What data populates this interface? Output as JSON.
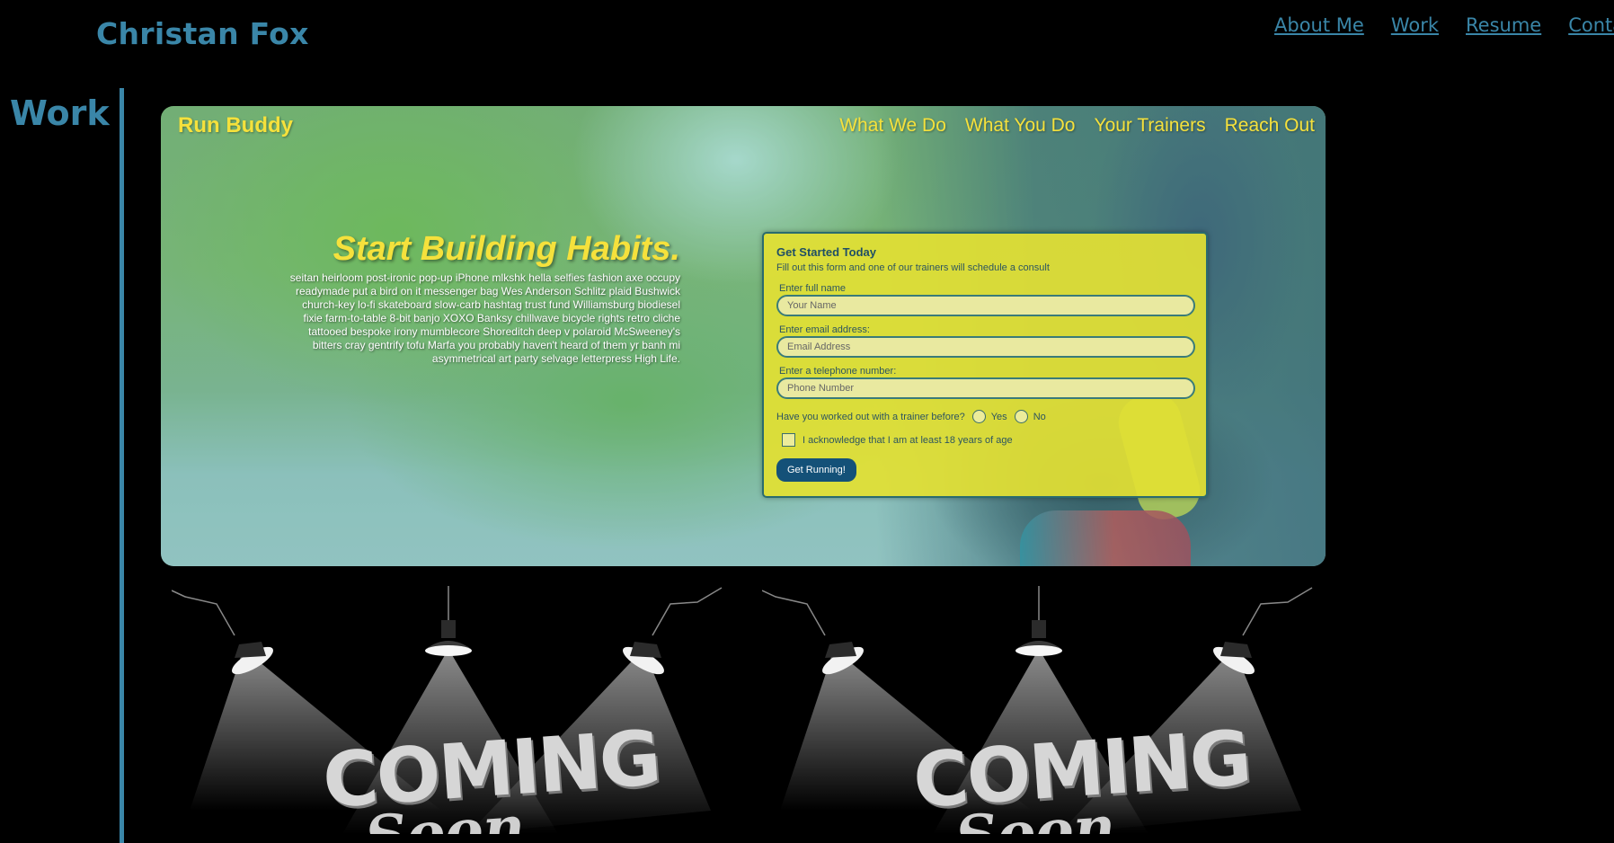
{
  "header": {
    "brand": "Christan Fox",
    "nav": [
      "About Me",
      "Work",
      "Resume",
      "Contac"
    ]
  },
  "section": {
    "title": "Work"
  },
  "project": {
    "logo": "Run Buddy",
    "nav": [
      "What We Do",
      "What You Do",
      "Your Trainers",
      "Reach Out"
    ],
    "hero_title": "Start Building Habits.",
    "hero_text": "seitan heirloom post-ironic pop-up iPhone mlkshk hella selfies fashion axe occupy readymade put a bird on it messenger bag Wes Anderson Schlitz plaid Bushwick church-key lo-fi skateboard slow-carb hashtag trust fund Williamsburg biodiesel fixie farm-to-table 8-bit banjo XOXO Banksy chillwave bicycle rights retro cliche tattooed bespoke irony mumblecore Shoreditch deep v polaroid McSweeney's bitters cray gentrify tofu Marfa you probably haven't heard of them yr banh mi asymmetrical art party selvage letterpress High Life.",
    "form": {
      "title": "Get Started Today",
      "subtitle": "Fill out this form and one of our trainers will schedule a consult",
      "name_label": "Enter full name",
      "name_placeholder": "Your Name",
      "email_label": "Enter email address:",
      "email_placeholder": "Email Address",
      "phone_label": "Enter a telephone number:",
      "phone_placeholder": "Phone Number",
      "question": "Have you worked out with a trainer before?",
      "yes": "Yes",
      "no": "No",
      "acknowledge": "I acknowledge that I am at least 18 years of age",
      "submit": "Get Running!"
    }
  },
  "placeholders": [
    {
      "line1": "COMING",
      "line2": "Soon"
    },
    {
      "line1": "COMING",
      "line2": "Soon"
    }
  ],
  "colors": {
    "accent": "#3a86a8",
    "runbuddy_yellow": "#f5e13c",
    "form_bg": "#e2e034",
    "button_bg": "#145178"
  }
}
